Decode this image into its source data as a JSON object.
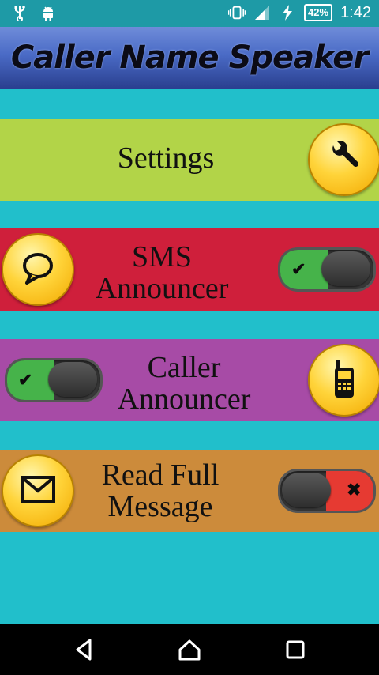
{
  "status_bar": {
    "battery": "42%",
    "time": "1:42",
    "icons": [
      "usb-icon",
      "android-icon",
      "vibrate-icon",
      "signal-icon",
      "charging-icon"
    ]
  },
  "app": {
    "title": "Caller Name Speaker"
  },
  "rows": {
    "settings": {
      "label": "Settings",
      "color": "#b2d448",
      "icon": "wrench-icon"
    },
    "sms": {
      "line1": "SMS",
      "line2": "Announcer",
      "color": "#cf1f3b",
      "icon": "chat-bubble-icon",
      "toggle": "on"
    },
    "caller": {
      "line1": "Caller",
      "line2": "Announcer",
      "color": "#a74ba6",
      "icon": "mobile-phone-icon",
      "toggle": "on"
    },
    "read_full": {
      "line1": "Read Full",
      "line2": "Message",
      "color": "#cc8b3b",
      "icon": "envelope-icon",
      "toggle": "off"
    }
  },
  "colors": {
    "background": "#21bfcb",
    "status_bar": "#1e9aa6",
    "toggle_on": "#46b34a",
    "toggle_off": "#e63a32"
  },
  "nav_bar": {
    "buttons": [
      "back-icon",
      "home-icon",
      "recents-icon"
    ]
  }
}
